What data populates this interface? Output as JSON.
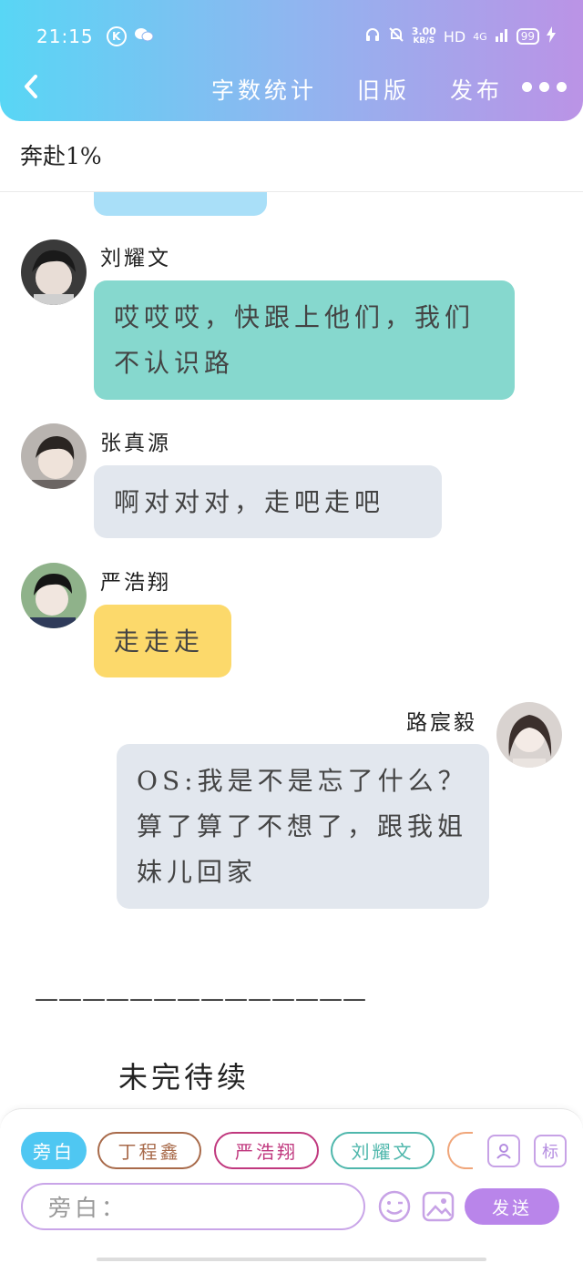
{
  "status_bar": {
    "time": "21:15",
    "k_icon": "K",
    "speed_value": "3.00",
    "speed_unit": "KB/S",
    "hd": "HD",
    "network": "4G",
    "battery": "99"
  },
  "nav": {
    "items": [
      "字数统计",
      "旧版",
      "发布"
    ]
  },
  "subtitle": "奔赴1%",
  "messages": [
    {
      "name": "刘耀文",
      "text": "哎哎哎，快跟上他们，我们不认识路",
      "color": "#86d8ce"
    },
    {
      "name": "张真源",
      "text": "啊对对对，走吧走吧",
      "color": "#e2e7ee"
    },
    {
      "name": "严浩翔",
      "text": "走走走",
      "color": "#fcd96b"
    },
    {
      "name": "路宸毅",
      "text": "OS:我是不是忘了什么？算了算了不想了，跟我姐妹儿回家",
      "color": "#e2e7ee"
    }
  ],
  "separator": "——————————————",
  "to_be_continued": "未完待续",
  "composer": {
    "chips": [
      "旁白",
      "丁程鑫",
      "严浩翔",
      "刘耀文"
    ],
    "tag_button": "标",
    "input_placeholder": "旁白：",
    "send_label": "发送"
  },
  "colors": {
    "header_start": "#58d6f5",
    "header_end": "#bb93e6",
    "accent_purple": "#b985ea",
    "chip_active": "#4fc7f2"
  }
}
